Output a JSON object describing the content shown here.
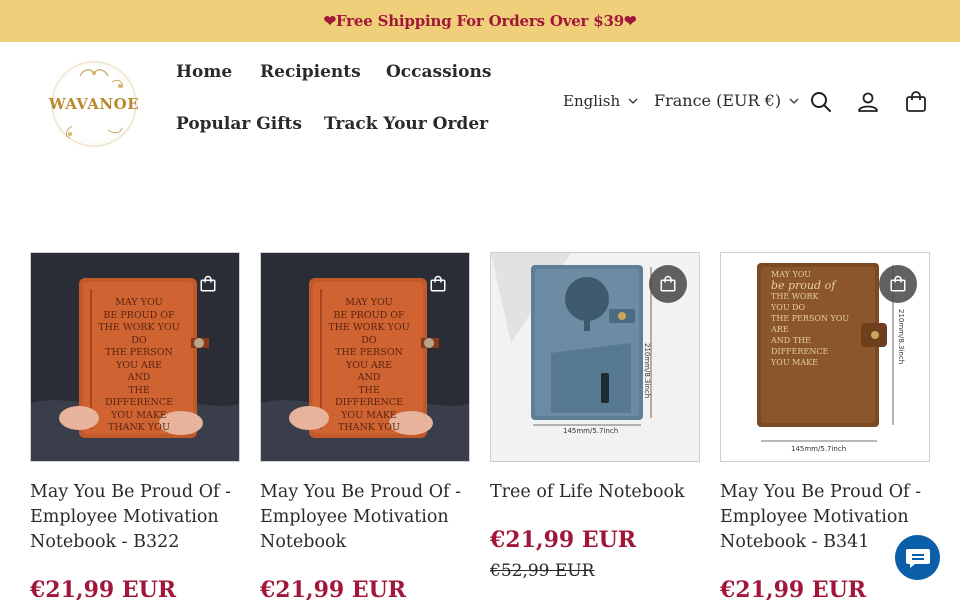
{
  "announcement": {
    "text": "❤Free Shipping For Orders Over $39❤"
  },
  "header": {
    "logo_text": "WAVANOE",
    "nav": [
      {
        "label": "Home"
      },
      {
        "label": "Recipients"
      },
      {
        "label": "Occassions"
      },
      {
        "label": "Popular Gifts"
      },
      {
        "label": "Track Your Order"
      }
    ],
    "language": "English",
    "country": "France (EUR €)",
    "icons": [
      "search-icon",
      "account-icon",
      "cart-icon"
    ]
  },
  "products": [
    {
      "title": "May You Be Proud Of - Employee Motivation Notebook - B322",
      "price": "€21,99 EUR",
      "compare_price": "",
      "image": "orange-leather-journal"
    },
    {
      "title": "May You Be Proud Of - Employee Motivation Notebook",
      "price": "€21,99 EUR",
      "compare_price": "",
      "image": "orange-leather-journal"
    },
    {
      "title": "Tree of Life Notebook",
      "price": "€21,99 EUR",
      "compare_price": "€52,99 EUR",
      "image": "blue-tree-notebook",
      "dimensions": {
        "height": "210mm/8.3inch",
        "width": "145mm/5.7inch"
      }
    },
    {
      "title": "May You Be Proud Of - Employee Motivation Notebook - B341",
      "price": "€21,99 EUR",
      "compare_price": "",
      "image": "brown-binder-notebook",
      "dimensions": {
        "height": "210mm/8.3inch",
        "width": "145mm/5.7inch"
      },
      "cover_text": [
        "MAY YOU",
        "be proud of",
        "THE WORK",
        "YOU DO",
        "THE PERSON YOU ARE",
        "AND THE DIFFERENCE",
        "YOU MAKE"
      ]
    }
  ],
  "journal_text": [
    "MAY YOU",
    "BE PROUD OF",
    "THE WORK YOU DO",
    "THE PERSON YOU ARE",
    "AND",
    "THE DIFFERENCE",
    "YOU MAKE",
    "THANK YOU"
  ],
  "colors": {
    "announcement_bg": "#f0cf7a",
    "accent": "#a0173a",
    "chat": "#0a5fa8"
  }
}
